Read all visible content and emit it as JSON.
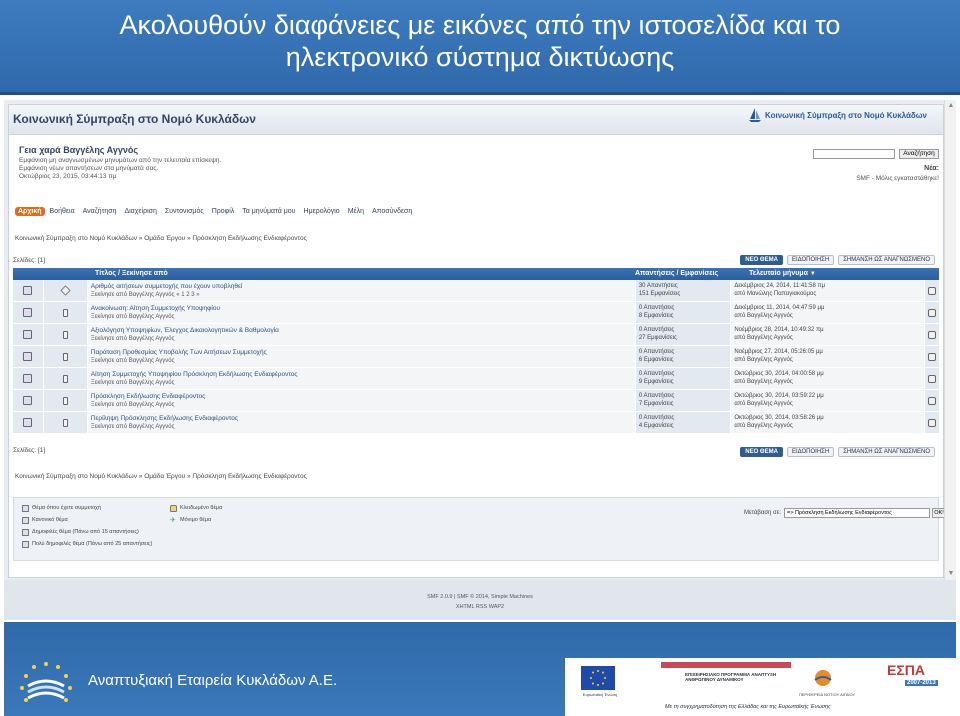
{
  "slide": {
    "title_line1": "Ακολουθούν διαφάνειες με εικόνες από την ιστοσελίδα και το",
    "title_line2": "ηλεκτρονικό σύστημα δικτύωσης"
  },
  "forum": {
    "site_title": "Κοινωνική Σύμπραξη στο Νομό Κυκλάδων",
    "logo_text": "Κοινωνική Σύμπραξη στο Νομό Κυκλάδων",
    "greeting": "Γεια χαρά Βαγγέλης Αγγνός",
    "user_links": [
      "Εμφάνιση μη αναγνωσμένων μηνυμάτων από την τελευταία επίσκεψη.",
      "Εμφάνιση νέων απαντήσεων στα μηνύματά σας.",
      "Οκτώβριος 23, 2015, 03:44:13 πμ"
    ],
    "search_button": "Αναζήτηση",
    "news_label": "Νέα:",
    "news_text": "SMF - Μόλις εγκαταστάθηκε!",
    "menu": [
      "Αρχική",
      "Βοήθεια",
      "Αναζήτηση",
      "Διαχείριση",
      "Συντονισμός",
      "Προφίλ",
      "Τα μηνύματά μου",
      "Ημερολόγιο",
      "Μέλη",
      "Αποσύνδεση"
    ],
    "breadcrumb": "Κοινωνική Σύμπραξη στο Νομό Κυκλάδων » Ομάδα Έργου » Πρόσκληση Εκδήλωσης Ενδιαφέροντος",
    "pages": "Σελίδες: [1]",
    "buttons": [
      "ΝΕΟ ΘΕΜΑ",
      "ΕΙΔΟΠΟΙΗΣΗ",
      "ΣΗΜΑΝΣΗ ΩΣ ΑΝΑΓΝΩΣΜΕΝΟ"
    ],
    "table_headers": {
      "subject": "Τίτλος / Ξεκίνησε από",
      "replies": "Απαντήσεις / Εμφανίσεις",
      "last": "Τελευταίο μήνυμα"
    },
    "topics": [
      {
        "title": "Αριθμός αιτήσεων συμμετοχής που έχουν υποβληθεί",
        "author": "Ξεκίνησε από Βαγγέλης Αγγνός « 1 2 3 »",
        "replies": "30 Απαντήσεις",
        "views": "151 Εμφανίσεις",
        "last_date": "Δεκέμβριος 24, 2014, 11:41:58 πμ",
        "last_by": "από Μανώλης Παπαγιακούμος"
      },
      {
        "title": "Ανακοίνωση: Αίτηση Συμμετοχής Υποψηφίου",
        "author": "Ξεκίνησε από Βαγγέλης Αγγνός",
        "replies": "0 Απαντήσεις",
        "views": "8 Εμφανίσεις",
        "last_date": "Δεκέμβριος 11, 2014, 04:47:59 μμ",
        "last_by": "από Βαγγέλης Αγγνός"
      },
      {
        "title": "Αξιολόγηση Υποψηφίων, Έλεγχος Δικαιολογητικών & Βαθμολογία",
        "author": "Ξεκίνησε από Βαγγέλης Αγγνός",
        "replies": "0 Απαντήσεις",
        "views": "27 Εμφανίσεις",
        "last_date": "Νοέμβριος 28, 2014, 10:49:32 πμ",
        "last_by": "από Βαγγέλης Αγγνός"
      },
      {
        "title": "Παράταση Προθεσμίας Υποβολής Των Αιτήσεων Συμμετοχής",
        "author": "Ξεκίνησε από Βαγγέλης Αγγνός",
        "replies": "0 Απαντήσεις",
        "views": "6 Εμφανίσεις",
        "last_date": "Νοέμβριος 27, 2014, 05:26:05 μμ",
        "last_by": "από Βαγγέλης Αγγνός"
      },
      {
        "title": "Αίτηση Συμμετοχής Υποψηφίου Πρόσκληση Εκδήλωσης Ενδιαφέροντος",
        "author": "Ξεκίνησε από Βαγγέλης Αγγνός",
        "replies": "0 Απαντήσεις",
        "views": "9 Εμφανίσεις",
        "last_date": "Οκτώβριος 30, 2014, 04:00:58 μμ",
        "last_by": "από Βαγγέλης Αγγνός"
      },
      {
        "title": "Πρόσκληση Εκδήλωσης Ενδιαφέροντος",
        "author": "Ξεκίνησε από Βαγγέλης Αγγνός",
        "replies": "0 Απαντήσεις",
        "views": "7 Εμφανίσεις",
        "last_date": "Οκτώβριος 30, 2014, 03:59:22 μμ",
        "last_by": "από Βαγγέλης Αγγνός"
      },
      {
        "title": "Περίληψη Πρόσκλησης Εκδήλωσης Ενδιαφέροντος",
        "author": "Ξεκίνησε από Βαγγέλης Αγγνός",
        "replies": "0 Απαντήσεις",
        "views": "4 Εμφανίσεις",
        "last_date": "Οκτώβριος 30, 2014, 03:58:26 μμ",
        "last_by": "από Βαγγέλης Αγγνός"
      }
    ],
    "legend_left": [
      "Θέμα όπου έχετε συμμετοχή",
      "Κανονικό θέμα",
      "Δημοφιλές θέμα (Πάνω από 15 απαντήσεις)",
      "Πολύ δημοφιλές θέμα (Πάνω από 25 απαντήσεις)"
    ],
    "legend_right": [
      "Κλειδωμένο θέμα",
      "Μόνιμο θέμα"
    ],
    "jump_label": "Μετάβαση σε:",
    "jump_value": "=> Πρόσκληση Εκδήλωσης Ενδιαφέροντος",
    "go_button": "OK!",
    "smf_credit": "SMF 2.0.9 | SMF © 2014, Simple Machines",
    "footer_links": "XHTML   RSS   WAP2"
  },
  "bottom": {
    "company_name": "Αναπτυξιακή Εταιρεία Κυκλάδων Α.Ε.",
    "eu_flag_label": "Ευρωπαϊκή Ένωση",
    "program_text": "ΕΠΙΧΕΙΡΗΣΙΑΚΟ ΠΡΟΓΡΑΜΜΑ ΑΝΑΠΤΥΞΗ ΑΝΘΡΩΠΙΝΟΥ ΔΥΝΑΜΙΚΟΥ",
    "region_label": "ΠΕΡΙΦΕΡΕΙΑ ΝΟΤΙΟΥ ΑΙΓΑΙΟΥ",
    "espa": "ΕΣΠΑ",
    "espa_years": "2007-2013",
    "cofinance_text": "Με τη συγχρηματοδότηση της Ελλάδας και της Ευρωπαϊκής Ένωσης"
  },
  "colors": {
    "slide_blue": "#2e69ab",
    "forum_header_blue": "#2c5e9c",
    "active_menu_orange": "#e36a1a",
    "espa_red": "#c43a32"
  }
}
